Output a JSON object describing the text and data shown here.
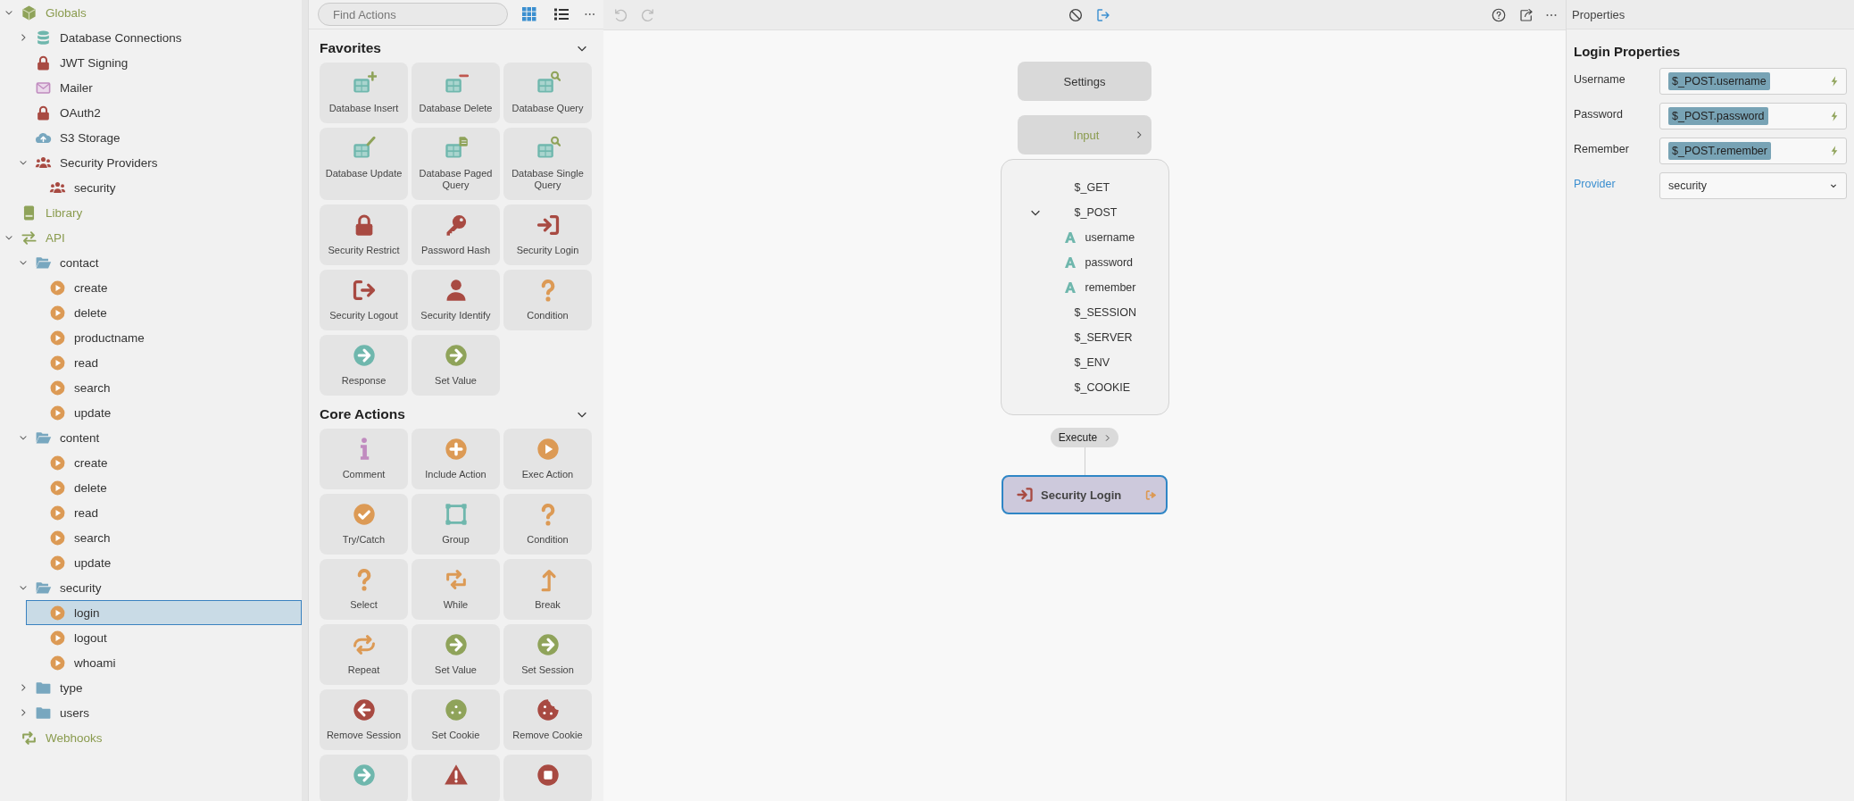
{
  "tree": [
    {
      "label": "Globals",
      "kind": "cube",
      "expanded": true,
      "selected": false,
      "children": [
        {
          "label": "Database Connections",
          "kind": "database",
          "expanded": false,
          "selected": false
        },
        {
          "label": "JWT Signing",
          "kind": "lock",
          "selected": false
        },
        {
          "label": "Mailer",
          "kind": "mail",
          "selected": false
        },
        {
          "label": "OAuth2",
          "kind": "lock",
          "selected": false
        },
        {
          "label": "S3 Storage",
          "kind": "cloud",
          "selected": false
        },
        {
          "label": "Security Providers",
          "kind": "users",
          "expanded": true,
          "selected": false,
          "children": [
            {
              "label": "security",
              "kind": "users",
              "selected": false
            }
          ]
        }
      ]
    },
    {
      "label": "Library",
      "kind": "book",
      "selected": false
    },
    {
      "label": "API",
      "kind": "swap",
      "expanded": true,
      "selected": false,
      "children": [
        {
          "label": "contact",
          "kind": "folder",
          "expanded": true,
          "selected": false,
          "children": [
            {
              "label": "create",
              "kind": "play",
              "selected": false
            },
            {
              "label": "delete",
              "kind": "play",
              "selected": false
            },
            {
              "label": "productname",
              "kind": "play",
              "selected": false
            },
            {
              "label": "read",
              "kind": "play",
              "selected": false
            },
            {
              "label": "search",
              "kind": "play",
              "selected": false
            },
            {
              "label": "update",
              "kind": "play",
              "selected": false
            }
          ]
        },
        {
          "label": "content",
          "kind": "folder",
          "expanded": true,
          "selected": false,
          "children": [
            {
              "label": "create",
              "kind": "play",
              "selected": false
            },
            {
              "label": "delete",
              "kind": "play",
              "selected": false
            },
            {
              "label": "read",
              "kind": "play",
              "selected": false
            },
            {
              "label": "search",
              "kind": "play",
              "selected": false
            },
            {
              "label": "update",
              "kind": "play",
              "selected": false
            }
          ]
        },
        {
          "label": "security",
          "kind": "folder",
          "expanded": true,
          "selected": false,
          "children": [
            {
              "label": "login",
              "kind": "play",
              "selected": true
            },
            {
              "label": "logout",
              "kind": "play",
              "selected": false
            },
            {
              "label": "whoami",
              "kind": "play",
              "selected": false
            }
          ]
        },
        {
          "label": "type",
          "kind": "folder",
          "expanded": false,
          "selected": false
        },
        {
          "label": "users",
          "kind": "folder",
          "expanded": false,
          "selected": false
        }
      ]
    },
    {
      "label": "Webhooks",
      "kind": "loop",
      "selected": false
    }
  ],
  "actions": {
    "search": {
      "placeholder": "Find Actions"
    },
    "view_modes": [
      {
        "kind": "grid",
        "selected": true
      },
      {
        "kind": "list",
        "selected": false
      }
    ],
    "sections": [
      {
        "title": "Favorites",
        "expanded": true,
        "items": [
          {
            "label": "Database Insert",
            "kind": "db-insert"
          },
          {
            "label": "Database Delete",
            "kind": "db-delete"
          },
          {
            "label": "Database Query",
            "kind": "db-query"
          },
          {
            "label": "Database Update",
            "kind": "db-update"
          },
          {
            "label": "Database Paged Query",
            "kind": "db-paged"
          },
          {
            "label": "Database Single Query",
            "kind": "db-query"
          },
          {
            "label": "Security Restrict",
            "kind": "restrict"
          },
          {
            "label": "Password Hash",
            "kind": "hash"
          },
          {
            "label": "Security Login",
            "kind": "login"
          },
          {
            "label": "Security Logout",
            "kind": "logout"
          },
          {
            "label": "Security Identify",
            "kind": "identify"
          },
          {
            "label": "Condition",
            "kind": "condition"
          },
          {
            "label": "Response",
            "kind": "response"
          },
          {
            "label": "Set Value",
            "kind": "setvalue"
          }
        ]
      },
      {
        "title": "Core Actions",
        "expanded": true,
        "items": [
          {
            "label": "Comment",
            "kind": "comment"
          },
          {
            "label": "Include Action",
            "kind": "include"
          },
          {
            "label": "Exec Action",
            "kind": "exec"
          },
          {
            "label": "Try/Catch",
            "kind": "trycatch"
          },
          {
            "label": "Group",
            "kind": "group"
          },
          {
            "label": "Condition",
            "kind": "condition"
          },
          {
            "label": "Select",
            "kind": "condition"
          },
          {
            "label": "While",
            "kind": "while"
          },
          {
            "label": "Break",
            "kind": "break"
          },
          {
            "label": "Repeat",
            "kind": "repeat"
          },
          {
            "label": "Set Value",
            "kind": "setvalue"
          },
          {
            "label": "Set Session",
            "kind": "setvalue"
          },
          {
            "label": "Remove Session",
            "kind": "removesession"
          },
          {
            "label": "Set Cookie",
            "kind": "setcookie"
          },
          {
            "label": "Remove Cookie",
            "kind": "removecookie"
          },
          {
            "kind": "response"
          },
          {
            "kind": "throw"
          },
          {
            "kind": "end"
          }
        ]
      }
    ]
  },
  "canvas": {
    "history": [
      {
        "kind": "undo",
        "disabled": true
      },
      {
        "kind": "redo",
        "disabled": true
      }
    ],
    "settings": {
      "label": "Settings"
    },
    "input": {
      "label": "Input"
    },
    "variables": [
      {
        "label": "$_GET"
      },
      {
        "label": "$_POST",
        "expanded": true,
        "children": [
          {
            "label": "username"
          },
          {
            "label": "password"
          },
          {
            "label": "remember"
          }
        ]
      },
      {
        "label": "$_SESSION"
      },
      {
        "label": "$_SERVER"
      },
      {
        "label": "$_ENV"
      },
      {
        "label": "$_COOKIE"
      }
    ],
    "execute": {
      "label": "Execute"
    },
    "step": {
      "label": "Security Login",
      "selected": true
    }
  },
  "properties": {
    "title": "Properties",
    "heading": "Login Properties",
    "fields": [
      {
        "label": "Username",
        "value": "$_POST.username",
        "kind": "binding"
      },
      {
        "label": "Password",
        "value": "$_POST.password",
        "kind": "binding"
      },
      {
        "label": "Remember",
        "value": "$_POST.remember",
        "kind": "binding"
      },
      {
        "label": "Provider",
        "value": "security",
        "kind": "select"
      }
    ]
  }
}
